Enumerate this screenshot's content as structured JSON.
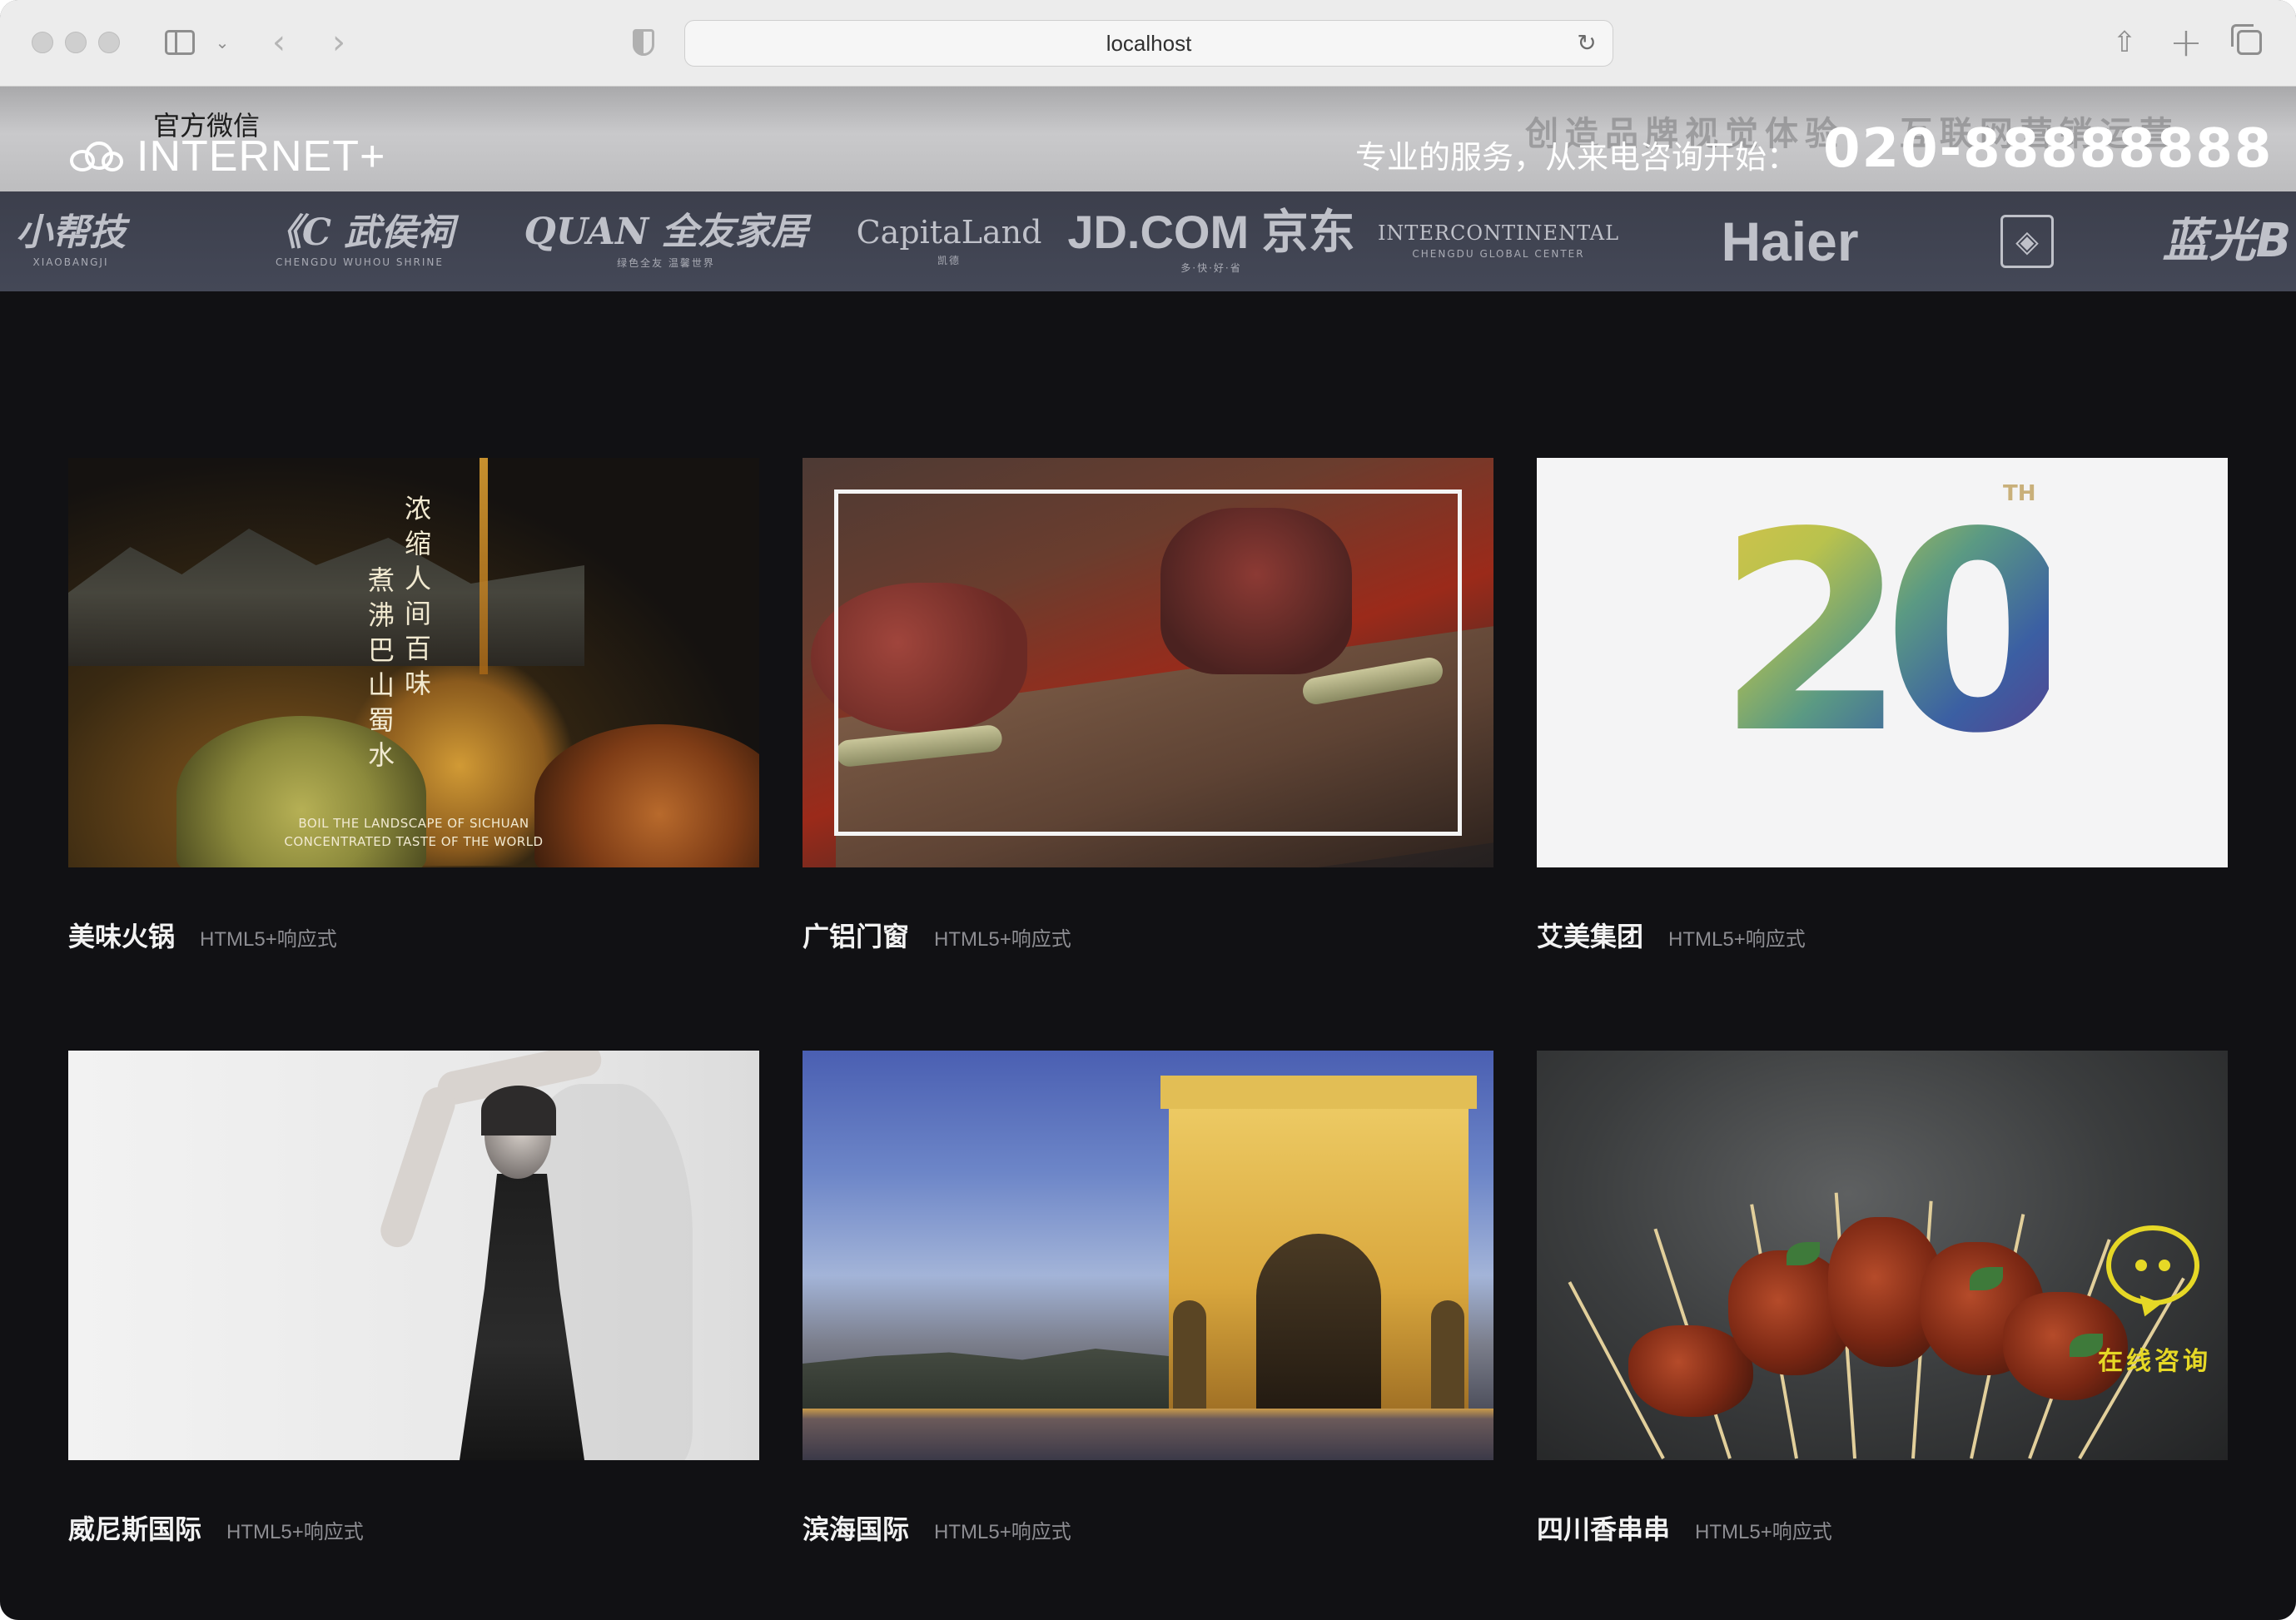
{
  "browser": {
    "url": "localhost"
  },
  "header": {
    "wechat_label": "官方微信",
    "logo_text": "INTERNET+",
    "slogan_faded": "创造品牌视觉体验 · 互联网营销运营",
    "service_text": "专业的服务，从来电咨询开始：",
    "hotline": "020-88888888"
  },
  "clients": [
    {
      "main": "小帮技",
      "sub": "XIAOBANGJI"
    },
    {
      "main": "《C 武侯祠",
      "sub": "CHENGDU WUHOU SHRINE"
    },
    {
      "main": "QUAN 全友家居",
      "sub": "绿色全友 温馨世界"
    },
    {
      "main": "CapitaLand",
      "sub": "凯德"
    },
    {
      "main": "JD.COM 京东",
      "sub": "多·快·好·省"
    },
    {
      "main": "INTERCONTINENTAL",
      "sub": "CHENGDU GLOBAL CENTER"
    },
    {
      "main": "Haier",
      "sub": ""
    },
    {
      "main": "◈",
      "sub": ""
    },
    {
      "main": "蓝光B",
      "sub": ""
    }
  ],
  "projects": [
    {
      "title": "美味火锅",
      "tag": "HTML5+响应式",
      "poem_a": "浓缩人间百味",
      "poem_b": "煮沸巴山蜀水",
      "en_line1": "BOIL THE LANDSCAPE OF SICHUAN",
      "en_line2": "CONCENTRATED TASTE OF THE WORLD"
    },
    {
      "title": "广铝门窗",
      "tag": "HTML5+响应式"
    },
    {
      "title": "艾美集团",
      "tag": "HTML5+响应式",
      "big_number": "20",
      "suffix": "TH"
    },
    {
      "title": "威尼斯国际",
      "tag": "HTML5+响应式"
    },
    {
      "title": "滨海国际",
      "tag": "HTML5+响应式"
    },
    {
      "title": "四川香串串",
      "tag": "HTML5+响应式",
      "consult_label": "在线咨询"
    }
  ]
}
